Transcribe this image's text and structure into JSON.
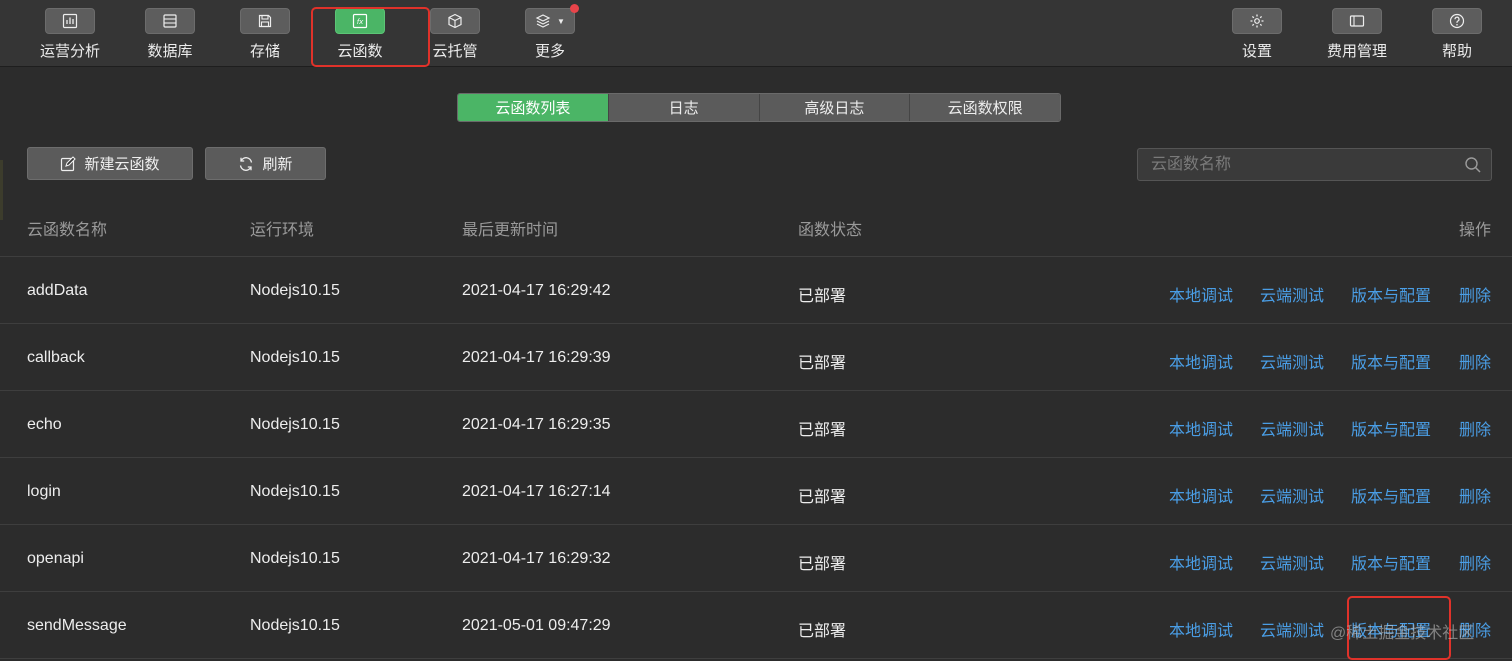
{
  "toolbar": {
    "items": [
      {
        "label": "运营分析",
        "icon": "bar-chart-icon"
      },
      {
        "label": "数据库",
        "icon": "database-icon"
      },
      {
        "label": "存储",
        "icon": "save-icon"
      },
      {
        "label": "云函数",
        "icon": "function-icon",
        "active": true
      },
      {
        "label": "云托管",
        "icon": "cube-icon"
      },
      {
        "label": "更多",
        "icon": "layers-icon"
      }
    ],
    "right_items": [
      {
        "label": "设置",
        "icon": "gear-icon"
      },
      {
        "label": "费用管理",
        "icon": "billing-icon"
      },
      {
        "label": "帮助",
        "icon": "help-icon"
      }
    ]
  },
  "tabs": [
    {
      "label": "云函数列表",
      "active": true
    },
    {
      "label": "日志"
    },
    {
      "label": "高级日志"
    },
    {
      "label": "云函数权限"
    }
  ],
  "actions": {
    "new_function": "新建云函数",
    "refresh": "刷新"
  },
  "search": {
    "placeholder": "云函数名称"
  },
  "table": {
    "headers": {
      "name": "云函数名称",
      "runtime": "运行环境",
      "updated": "最后更新时间",
      "status": "函数状态",
      "ops": "操作"
    },
    "op_labels": [
      "本地调试",
      "云端测试",
      "版本与配置",
      "删除"
    ],
    "rows": [
      {
        "name": "addData",
        "runtime": "Nodejs10.15",
        "updated": "2021-04-17 16:29:42",
        "status": "已部署"
      },
      {
        "name": "callback",
        "runtime": "Nodejs10.15",
        "updated": "2021-04-17 16:29:39",
        "status": "已部署"
      },
      {
        "name": "echo",
        "runtime": "Nodejs10.15",
        "updated": "2021-04-17 16:29:35",
        "status": "已部署"
      },
      {
        "name": "login",
        "runtime": "Nodejs10.15",
        "updated": "2021-04-17 16:27:14",
        "status": "已部署"
      },
      {
        "name": "openapi",
        "runtime": "Nodejs10.15",
        "updated": "2021-04-17 16:29:32",
        "status": "已部署"
      },
      {
        "name": "sendMessage",
        "runtime": "Nodejs10.15",
        "updated": "2021-05-01 09:47:29",
        "status": "已部署"
      }
    ]
  },
  "watermark": "@稀土掘金技术社区",
  "colors": {
    "accent_green": "#4bb566",
    "link_blue": "#4a9ee6",
    "highlight_red": "#e0322a"
  }
}
